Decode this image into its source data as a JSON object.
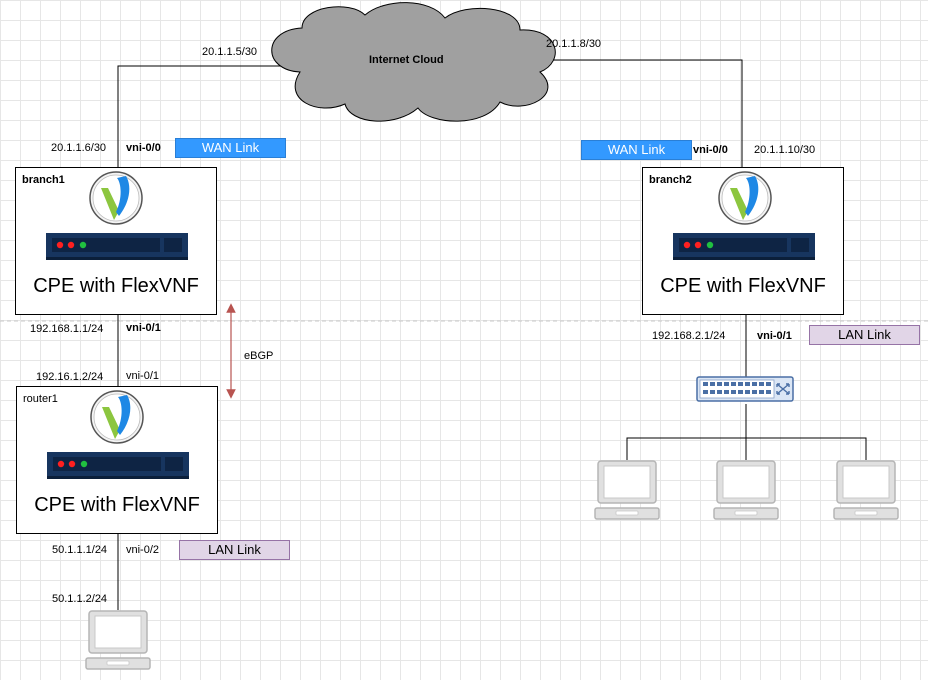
{
  "cloud": {
    "label": "Internet Cloud"
  },
  "boxes": {
    "branch1": {
      "name": "branch1",
      "title": "CPE with FlexVNF"
    },
    "branch2": {
      "name": "branch2",
      "title": "CPE with FlexVNF"
    },
    "router1": {
      "name": "router1",
      "title": "CPE with FlexVNF"
    }
  },
  "labels": {
    "ip_20_1_1_5": "20.1.1.5/30",
    "ip_20_1_1_8": "20.1.1.8/30",
    "ip_20_1_1_6": "20.1.1.6/30",
    "vni_b1_wan": "vni-0/0",
    "vni_b2_wan": "vni-0/0",
    "ip_20_1_1_10": "20.1.1.10/30",
    "ip_192_168_1_1": "192.168.1.1/24",
    "vni_b1_lan": "vni-0/1",
    "ip_192_16_1_2": "192.16.1.2/24",
    "vni_r1_up": "vni-0/1",
    "ebgp": "eBGP",
    "ip_192_168_2_1": "192.168.2.1/24",
    "vni_b2_lan": "vni-0/1",
    "ip_50_1_1_1": "50.1.1.1/24",
    "vni_r1_lan": "vni-0/2",
    "ip_50_1_1_2": "50.1.1.2/24"
  },
  "links": {
    "wan1": "WAN Link",
    "wan2": "WAN Link",
    "lan_b2": "LAN Link",
    "lan_r1": "LAN Link"
  },
  "colors": {
    "wan_link": "#3399ff",
    "lan_link": "#e1d5e7",
    "cloud": "#a0a0a0",
    "ebgp_arrow": "#b85450",
    "device_body": "#17355f",
    "led_red": "#ff2020",
    "led_green": "#20c040"
  },
  "icons": [
    "versa-logo-icon",
    "cpe-device-icon",
    "network-switch-icon",
    "laptop-icon"
  ]
}
